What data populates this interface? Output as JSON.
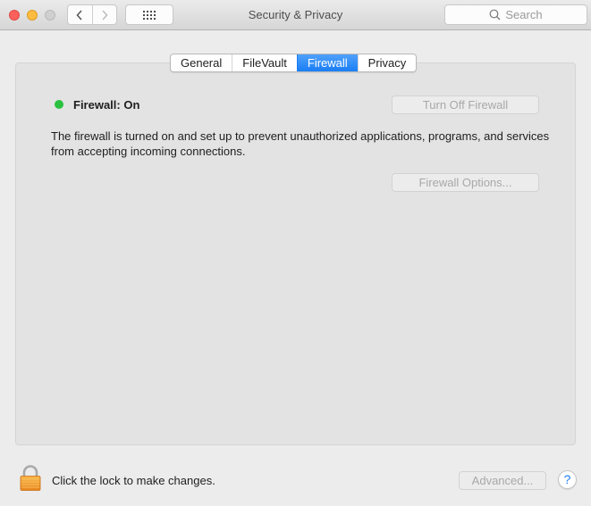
{
  "window": {
    "title": "Security & Privacy",
    "search_placeholder": "Search"
  },
  "tabs": [
    {
      "label": "General",
      "active": false
    },
    {
      "label": "FileVault",
      "active": false
    },
    {
      "label": "Firewall",
      "active": true
    },
    {
      "label": "Privacy",
      "active": false
    }
  ],
  "firewall": {
    "status_label": "Firewall: On",
    "status_color": "#2ac140",
    "description": "The firewall is turned on and set up to prevent unauthorized applications, programs, and services from accepting incoming connections.",
    "turn_off_label": "Turn Off Firewall",
    "options_label": "Firewall Options..."
  },
  "footer": {
    "lock_text": "Click the lock to make changes.",
    "advanced_label": "Advanced...",
    "help_label": "?"
  },
  "colors": {
    "accent": "#1a7ef5"
  }
}
